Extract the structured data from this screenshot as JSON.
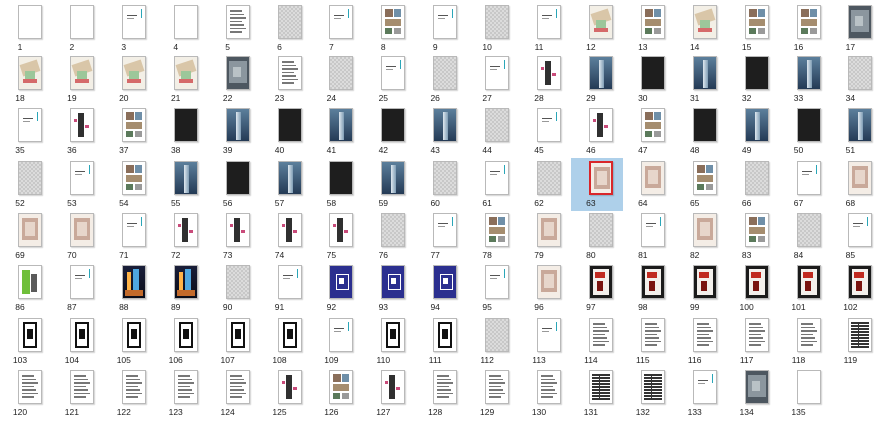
{
  "thumbnails": [
    {
      "label": "1",
      "style": "blank"
    },
    {
      "label": "2",
      "style": "blank"
    },
    {
      "label": "3",
      "style": "title"
    },
    {
      "label": "4",
      "style": "pattern"
    },
    {
      "label": "5",
      "style": "text"
    },
    {
      "label": "6",
      "style": "grey"
    },
    {
      "label": "7",
      "style": "title"
    },
    {
      "label": "8",
      "style": "images"
    },
    {
      "label": "9",
      "style": "title"
    },
    {
      "label": "10",
      "style": "grey"
    },
    {
      "label": "11",
      "style": "title"
    },
    {
      "label": "12",
      "style": "map"
    },
    {
      "label": "13",
      "style": "images"
    },
    {
      "label": "14",
      "style": "map"
    },
    {
      "label": "15",
      "style": "images"
    },
    {
      "label": "16",
      "style": "images"
    },
    {
      "label": "17",
      "style": "photo"
    },
    {
      "label": "18",
      "style": "map"
    },
    {
      "label": "19",
      "style": "map"
    },
    {
      "label": "20",
      "style": "map"
    },
    {
      "label": "21",
      "style": "map"
    },
    {
      "label": "22",
      "style": "photo"
    },
    {
      "label": "23",
      "style": "text"
    },
    {
      "label": "24",
      "style": "grey"
    },
    {
      "label": "25",
      "style": "title"
    },
    {
      "label": "26",
      "style": "grey"
    },
    {
      "label": "27",
      "style": "title"
    },
    {
      "label": "28",
      "style": "diagram"
    },
    {
      "label": "29",
      "style": "tower"
    },
    {
      "label": "30",
      "style": "dark"
    },
    {
      "label": "31",
      "style": "tower"
    },
    {
      "label": "32",
      "style": "dark"
    },
    {
      "label": "33",
      "style": "tower"
    },
    {
      "label": "34",
      "style": "grey"
    },
    {
      "label": "35",
      "style": "title"
    },
    {
      "label": "36",
      "style": "diagram"
    },
    {
      "label": "37",
      "style": "images"
    },
    {
      "label": "38",
      "style": "dark"
    },
    {
      "label": "39",
      "style": "tower"
    },
    {
      "label": "40",
      "style": "dark"
    },
    {
      "label": "41",
      "style": "tower"
    },
    {
      "label": "42",
      "style": "dark"
    },
    {
      "label": "43",
      "style": "tower"
    },
    {
      "label": "44",
      "style": "grey"
    },
    {
      "label": "45",
      "style": "title"
    },
    {
      "label": "46",
      "style": "diagram"
    },
    {
      "label": "47",
      "style": "images"
    },
    {
      "label": "48",
      "style": "dark"
    },
    {
      "label": "49",
      "style": "tower"
    },
    {
      "label": "50",
      "style": "dark"
    },
    {
      "label": "51",
      "style": "tower"
    },
    {
      "label": "52",
      "style": "grey"
    },
    {
      "label": "53",
      "style": "title"
    },
    {
      "label": "54",
      "style": "images"
    },
    {
      "label": "55",
      "style": "tower"
    },
    {
      "label": "56",
      "style": "dark"
    },
    {
      "label": "57",
      "style": "tower"
    },
    {
      "label": "58",
      "style": "dark"
    },
    {
      "label": "59",
      "style": "tower"
    },
    {
      "label": "60",
      "style": "grey"
    },
    {
      "label": "61",
      "style": "title"
    },
    {
      "label": "62",
      "style": "grey"
    },
    {
      "label": "63",
      "style": "plan"
    },
    {
      "label": "64",
      "style": "plan"
    },
    {
      "label": "65",
      "style": "images"
    },
    {
      "label": "66",
      "style": "grey"
    },
    {
      "label": "67",
      "style": "title"
    },
    {
      "label": "68",
      "style": "plan"
    },
    {
      "label": "69",
      "style": "plan"
    },
    {
      "label": "70",
      "style": "plan"
    },
    {
      "label": "71",
      "style": "title"
    },
    {
      "label": "72",
      "style": "diagram"
    },
    {
      "label": "73",
      "style": "diagram"
    },
    {
      "label": "74",
      "style": "diagram"
    },
    {
      "label": "75",
      "style": "diagram"
    },
    {
      "label": "76",
      "style": "grey"
    },
    {
      "label": "77",
      "style": "title"
    },
    {
      "label": "78",
      "style": "images"
    },
    {
      "label": "79",
      "style": "plan"
    },
    {
      "label": "80",
      "style": "grey"
    },
    {
      "label": "81",
      "style": "title"
    },
    {
      "label": "82",
      "style": "plan"
    },
    {
      "label": "83",
      "style": "images"
    },
    {
      "label": "84",
      "style": "grey"
    },
    {
      "label": "85",
      "style": "title"
    },
    {
      "label": "86",
      "style": "green"
    },
    {
      "label": "87",
      "style": "title"
    },
    {
      "label": "88",
      "style": "night"
    },
    {
      "label": "89",
      "style": "night"
    },
    {
      "label": "90",
      "style": "grey"
    },
    {
      "label": "91",
      "style": "title"
    },
    {
      "label": "92",
      "style": "navy"
    },
    {
      "label": "93",
      "style": "navy"
    },
    {
      "label": "94",
      "style": "navy"
    },
    {
      "label": "95",
      "style": "title"
    },
    {
      "label": "96",
      "style": "plan"
    },
    {
      "label": "97",
      "style": "red"
    },
    {
      "label": "98",
      "style": "red"
    },
    {
      "label": "99",
      "style": "red"
    },
    {
      "label": "100",
      "style": "red"
    },
    {
      "label": "101",
      "style": "red"
    },
    {
      "label": "102",
      "style": "red"
    },
    {
      "label": "103",
      "style": "bw"
    },
    {
      "label": "104",
      "style": "bw"
    },
    {
      "label": "105",
      "style": "bw"
    },
    {
      "label": "106",
      "style": "bw"
    },
    {
      "label": "107",
      "style": "bw"
    },
    {
      "label": "108",
      "style": "bw"
    },
    {
      "label": "109",
      "style": "title"
    },
    {
      "label": "110",
      "style": "bw"
    },
    {
      "label": "111",
      "style": "bw"
    },
    {
      "label": "112",
      "style": "grey"
    },
    {
      "label": "113",
      "style": "title"
    },
    {
      "label": "114",
      "style": "text"
    },
    {
      "label": "115",
      "style": "text"
    },
    {
      "label": "116",
      "style": "text"
    },
    {
      "label": "117",
      "style": "text"
    },
    {
      "label": "118",
      "style": "text"
    },
    {
      "label": "119",
      "style": "table"
    },
    {
      "label": "120",
      "style": "text"
    },
    {
      "label": "121",
      "style": "text"
    },
    {
      "label": "122",
      "style": "text"
    },
    {
      "label": "123",
      "style": "text"
    },
    {
      "label": "124",
      "style": "text"
    },
    {
      "label": "125",
      "style": "diagram"
    },
    {
      "label": "126",
      "style": "images"
    },
    {
      "label": "127",
      "style": "diagram"
    },
    {
      "label": "128",
      "style": "text"
    },
    {
      "label": "129",
      "style": "text"
    },
    {
      "label": "130",
      "style": "text"
    },
    {
      "label": "131",
      "style": "table"
    },
    {
      "label": "132",
      "style": "table"
    },
    {
      "label": "133",
      "style": "title"
    },
    {
      "label": "134",
      "style": "photo"
    },
    {
      "label": "135",
      "style": "blank"
    }
  ],
  "selected_label": "63",
  "colors": {
    "selection_bg": "#aed0ea",
    "selection_border": "#d9262a",
    "teal_accent": "#2aa6b8"
  }
}
